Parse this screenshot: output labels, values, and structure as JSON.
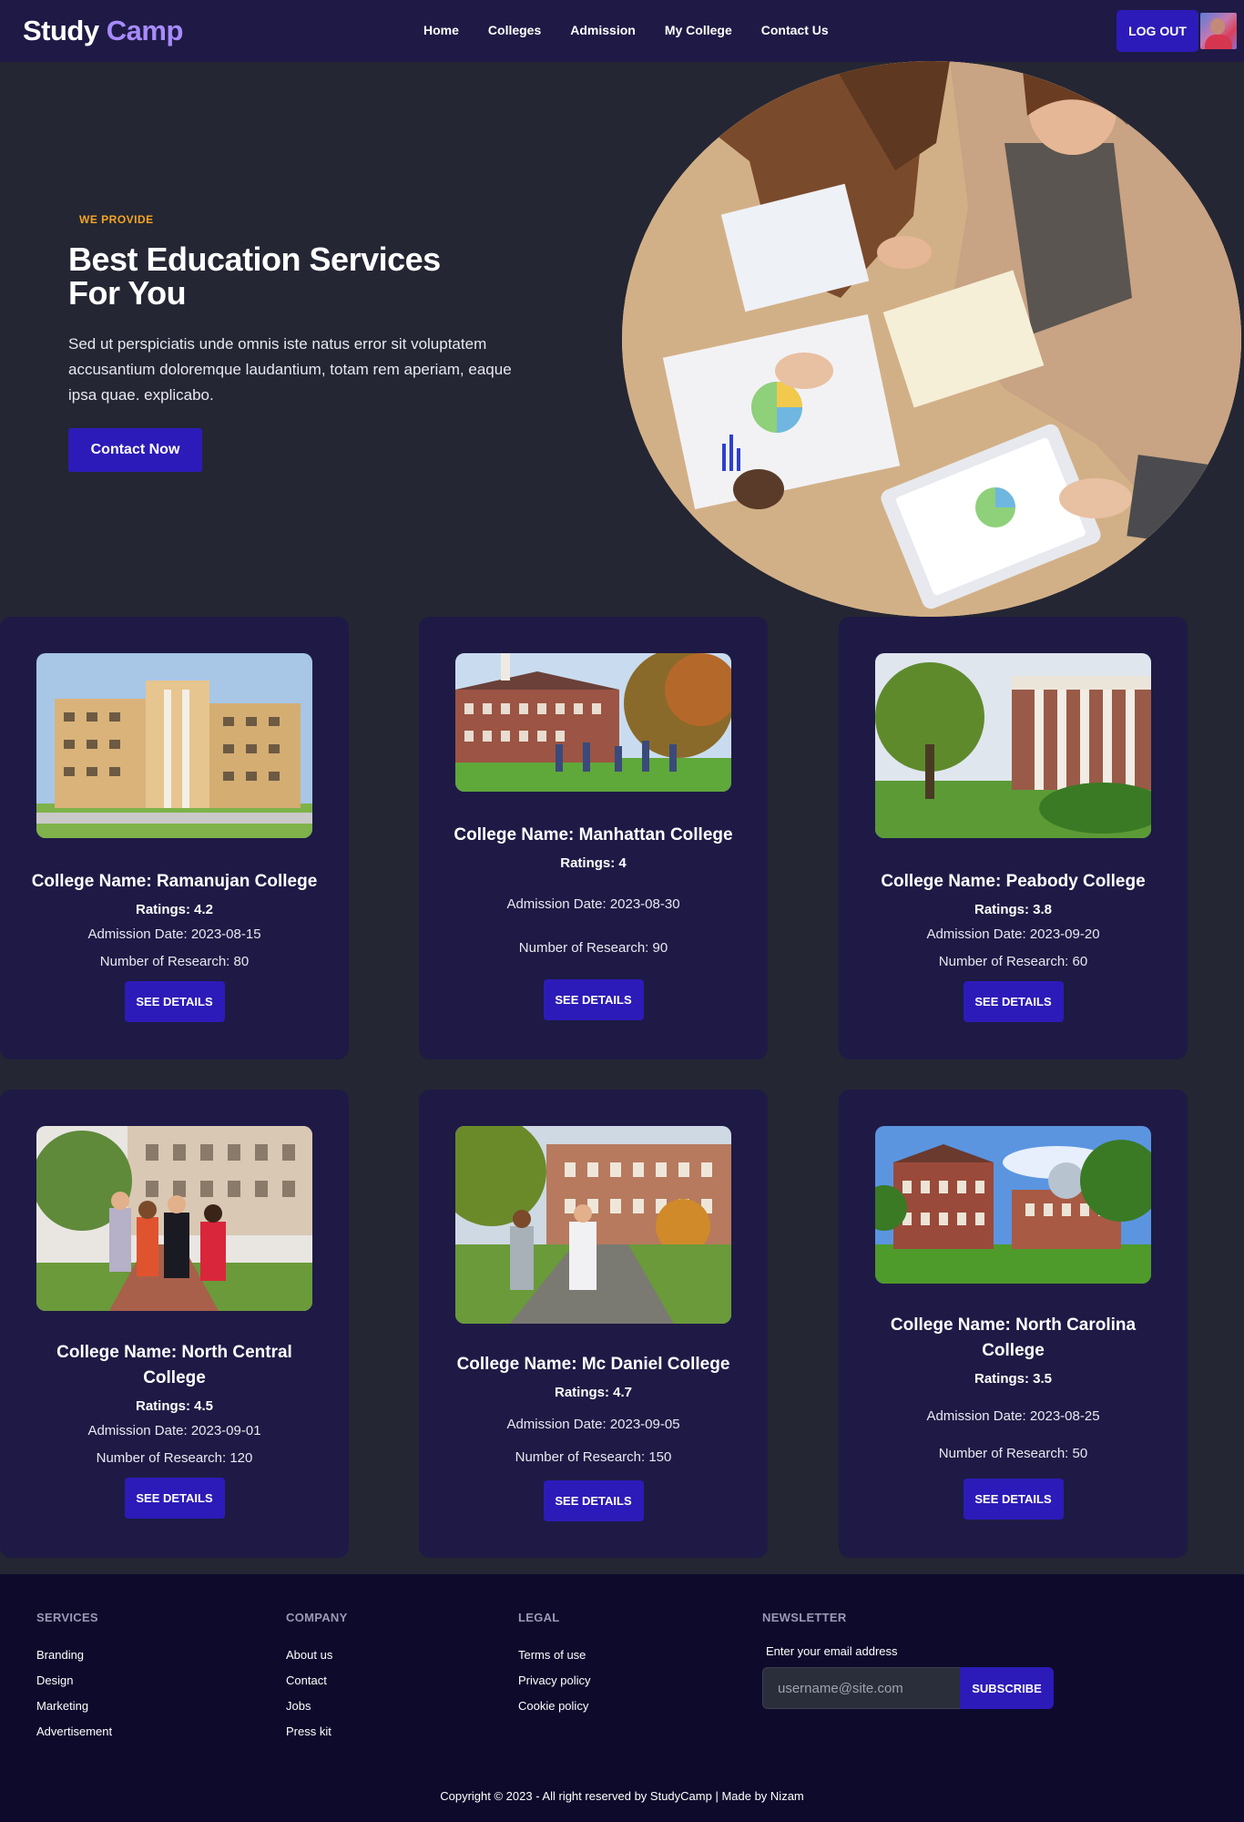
{
  "nav": {
    "brand_part1": "Study",
    "brand_part2": "Camp",
    "links": [
      "Home",
      "Colleges",
      "Admission",
      "My College",
      "Contact Us"
    ],
    "logout_label": "LOG OUT"
  },
  "hero": {
    "kicker": "WE PROVIDE",
    "title_line1": "Best Education Services",
    "title_line2": "For You",
    "text": "Sed ut perspiciatis unde omnis iste natus error sit voluptatem accusantium doloremque laudantium, totam rem aperiam, eaque ipsa quae. explicabo.",
    "cta_label": "Contact Now"
  },
  "colleges": [
    {
      "name": "College Name: Ramanujan College",
      "rating": "Ratings: 4.2",
      "admission": "Admission Date: 2023-08-15",
      "research": "Number of Research: 80",
      "button": "SEE DETAILS"
    },
    {
      "name": "College Name: Manhattan College",
      "rating": "Ratings: 4",
      "admission": "Admission Date: 2023-08-30",
      "research": "Number of Research: 90",
      "button": "SEE DETAILS"
    },
    {
      "name": "College Name: Peabody College",
      "rating": "Ratings: 3.8",
      "admission": "Admission Date: 2023-09-20",
      "research": "Number of Research: 60",
      "button": "SEE DETAILS"
    },
    {
      "name": "College Name: North Central College",
      "rating": "Ratings: 4.5",
      "admission": "Admission Date: 2023-09-01",
      "research": "Number of Research: 120",
      "button": "SEE DETAILS"
    },
    {
      "name": "College Name: Mc Daniel College",
      "rating": "Ratings: 4.7",
      "admission": "Admission Date: 2023-09-05",
      "research": "Number of Research: 150",
      "button": "SEE DETAILS"
    },
    {
      "name": "College Name: North Carolina College",
      "rating": "Ratings: 3.5",
      "admission": "Admission Date: 2023-08-25",
      "research": "Number of Research: 50",
      "button": "SEE DETAILS"
    }
  ],
  "footer": {
    "services": {
      "heading": "SERVICES",
      "links": [
        "Branding",
        "Design",
        "Marketing",
        "Advertisement"
      ]
    },
    "company": {
      "heading": "COMPANY",
      "links": [
        "About us",
        "Contact",
        "Jobs",
        "Press kit"
      ]
    },
    "legal": {
      "heading": "LEGAL",
      "links": [
        "Terms of use",
        "Privacy policy",
        "Cookie policy"
      ]
    },
    "newsletter": {
      "heading": "NEWSLETTER",
      "label": "Enter your email address",
      "placeholder": "username@site.com",
      "button": "SUBSCRIBE"
    },
    "copyright": "Copyright © 2023 - All right reserved by StudyCamp | Made by Nizam"
  },
  "colors": {
    "nav_bg": "#1e1a45",
    "page_bg": "#242633",
    "card_bg": "#1e1a45",
    "accent_button": "#2c1bb8",
    "kicker": "#f5a524",
    "brand_accent": "#a78bfa",
    "footer_bg": "#0e0a2b"
  },
  "icons": [
    "user-avatar"
  ]
}
